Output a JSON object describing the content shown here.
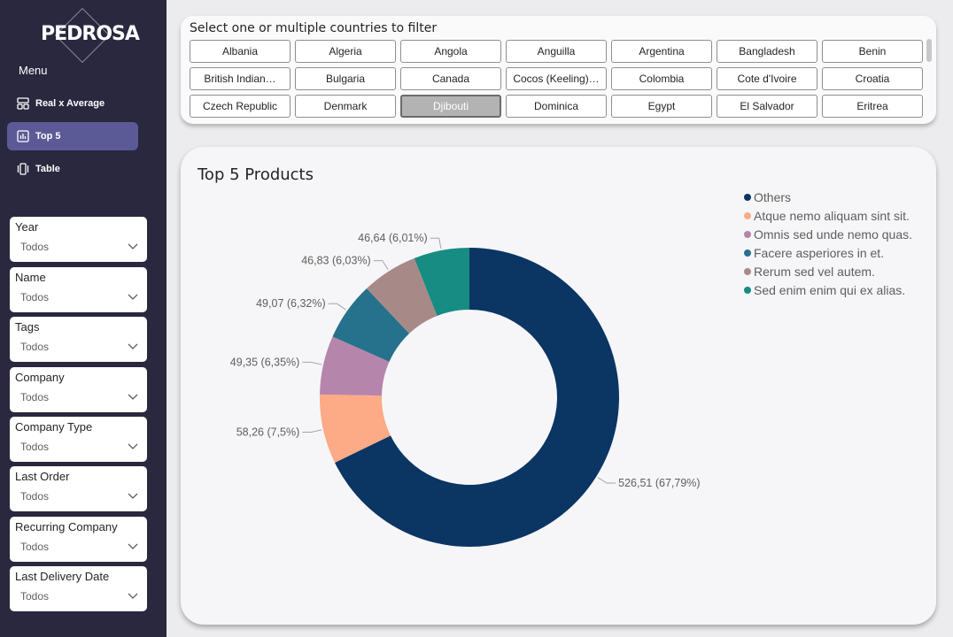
{
  "brand": {
    "logo_text": "PEDROSA"
  },
  "sidebar": {
    "menu_heading": "Menu",
    "items": [
      {
        "label": "Real x Average",
        "icon": "layout-icon",
        "active": false
      },
      {
        "label": "Top 5",
        "icon": "bar-chart-icon",
        "active": true
      },
      {
        "label": "Table",
        "icon": "carousel-icon",
        "active": false
      }
    ],
    "filters": [
      {
        "label": "Year",
        "value": "Todos"
      },
      {
        "label": "Name",
        "value": "Todos"
      },
      {
        "label": "Tags",
        "value": "Todos"
      },
      {
        "label": "Company",
        "value": "Todos"
      },
      {
        "label": "Company Type",
        "value": "Todos"
      },
      {
        "label": "Last Order",
        "value": "Todos"
      },
      {
        "label": "Recurring Company",
        "value": "Todos"
      },
      {
        "label": "Last Delivery Date",
        "value": "Todos"
      }
    ]
  },
  "country_filter": {
    "title": "Select one or multiple countries to filter",
    "countries": [
      "Albania",
      "Algeria",
      "Angola",
      "Anguilla",
      "Argentina",
      "Bangladesh",
      "Benin",
      "British Indian…",
      "Bulgaria",
      "Canada",
      "Cocos (Keeling)…",
      "Colombia",
      "Cote d'Ivoire",
      "Croatia",
      "Czech Republic",
      "Denmark",
      "Djibouti",
      "Dominica",
      "Egypt",
      "El Salvador",
      "Eritrea"
    ],
    "selected": "Djibouti"
  },
  "chart_data": {
    "type": "pie",
    "variant": "donut",
    "title": "Top 5 Products",
    "series": [
      {
        "name": "Others",
        "value": 526.51,
        "label": "526,51 (67,79%)",
        "color": "#0b3563"
      },
      {
        "name": "Atque nemo aliquam sint sit.",
        "value": 58.26,
        "label": "58,26 (7,5%)",
        "color": "#fdaa86"
      },
      {
        "name": "Omnis sed unde nemo quas.",
        "value": 49.35,
        "label": "49,35 (6,35%)",
        "color": "#b685ab"
      },
      {
        "name": "Facere asperiores in et.",
        "value": 49.07,
        "label": "49,07 (6,32%)",
        "color": "#26718c"
      },
      {
        "name": "Rerum sed vel autem.",
        "value": 46.83,
        "label": "46,83 (6,03%)",
        "color": "#a78a88"
      },
      {
        "name": "Sed enim enim qui ex alias.",
        "value": 46.64,
        "label": "46,64 (6,01%)",
        "color": "#168c82"
      }
    ],
    "legend_position": "top-right"
  }
}
